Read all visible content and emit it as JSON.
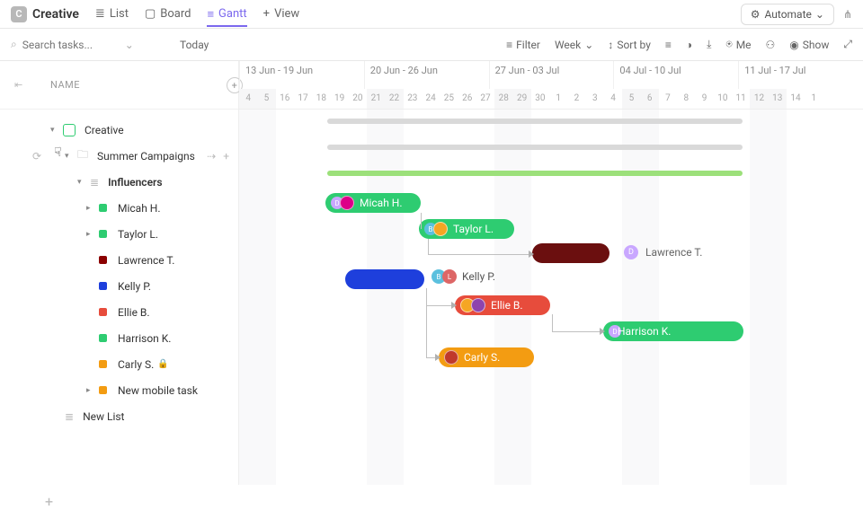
{
  "space": {
    "badge": "C",
    "name": "Creative"
  },
  "views": [
    {
      "id": "list",
      "label": "List",
      "glyph": "≣"
    },
    {
      "id": "board",
      "label": "Board",
      "glyph": "▢"
    },
    {
      "id": "gantt",
      "label": "Gantt",
      "glyph": "≡",
      "active": true
    },
    {
      "id": "add",
      "label": "View",
      "glyph": "+"
    }
  ],
  "automate": {
    "label": "Automate",
    "glyph": "✦"
  },
  "search": {
    "placeholder": "Search tasks...",
    "value": ""
  },
  "today": "Today",
  "toolbar": {
    "filter": "Filter",
    "group": "Week",
    "sort": "Sort by",
    "me": "Me",
    "show": "Show"
  },
  "sidebar": {
    "header": "NAME",
    "space": "Creative",
    "folder": "Summer Campaigns",
    "list": "Influencers",
    "tasks": [
      {
        "label": "Micah H.",
        "color": "#2ecc71",
        "caret": true
      },
      {
        "label": "Taylor L.",
        "color": "#2ecc71",
        "caret": true
      },
      {
        "label": "Lawrence T.",
        "color": "#8b0000"
      },
      {
        "label": "Kelly P.",
        "color": "#1e3fdc"
      },
      {
        "label": "Ellie B.",
        "color": "#e74c3c"
      },
      {
        "label": "Harrison K.",
        "color": "#2ecc71"
      },
      {
        "label": "Carly S.",
        "color": "#f39c12",
        "locked": true
      },
      {
        "label": "New mobile task",
        "color": "#f39c12",
        "caret": true
      }
    ],
    "newList": "New List"
  },
  "timeline": {
    "weeks": [
      {
        "label": "13 Jun - 19 Jun",
        "span": 7
      },
      {
        "label": "20 Jun - 26 Jun",
        "span": 7
      },
      {
        "label": "27 Jun - 03 Jul",
        "span": 7
      },
      {
        "label": "04 Jul - 10 Jul",
        "span": 7
      },
      {
        "label": "11 Jul - 17 Jul",
        "span": 7
      }
    ],
    "days": [
      "4",
      "5",
      "16",
      "17",
      "18",
      "19",
      "20",
      "21",
      "22",
      "23",
      "24",
      "25",
      "26",
      "27",
      "28",
      "29",
      "30",
      "1",
      "2",
      "3",
      "4",
      "5",
      "6",
      "7",
      "8",
      "9",
      "10",
      "11",
      "12",
      "13",
      "14",
      "1"
    ],
    "weekend_idx": [
      0,
      1,
      7,
      8,
      14,
      15,
      21,
      22,
      28,
      29
    ]
  },
  "bars": {
    "summary1": {
      "color": "#d9d9d9"
    },
    "summary2": {
      "color": "#d9d9d9"
    },
    "summary3": {
      "color": "#9ce07a"
    },
    "micah": {
      "label": "Micah H.",
      "color": "#2ecc71",
      "badge": "D",
      "badgeColor": "#c9a7ff"
    },
    "taylor": {
      "label": "Taylor L.",
      "color": "#2ecc71",
      "badge": "B",
      "badgeColor": "#5bc0de"
    },
    "lawrence": {
      "label": "Lawrence T.",
      "color": "#6b0f0f",
      "unscheduled": true,
      "badge": "D"
    },
    "kelly": {
      "label": "Kelly P.",
      "color": "#1e3fdc",
      "badge": "B",
      "badgeColor": "#5bc0de"
    },
    "ellie": {
      "label": "Ellie B.",
      "color": "#e74c3c"
    },
    "harrison": {
      "label": "Harrison K.",
      "color": "#2ecc71",
      "badge": "D",
      "badgeColor": "#c9a7ff"
    },
    "carly": {
      "label": "Carly S.",
      "color": "#f39c12"
    }
  },
  "chart_data": {
    "type": "gantt",
    "title": "Creative / Summer Campaigns / Influencers",
    "x_unit": "day",
    "x_range": [
      "2022-06-13",
      "2022-07-17"
    ],
    "tasks": [
      {
        "name": "Micah H.",
        "start": "2022-06-19",
        "end": "2022-06-23",
        "status": "green",
        "assignees": [
          "D"
        ]
      },
      {
        "name": "Taylor L.",
        "start": "2022-06-24",
        "end": "2022-06-28",
        "status": "green",
        "assignees": [
          "B",
          "A"
        ],
        "depends_on": [
          "Micah H."
        ]
      },
      {
        "name": "Lawrence T.",
        "start": "2022-06-30",
        "end": "2022-07-03",
        "status": "maroon",
        "unscheduled_label": true
      },
      {
        "name": "Kelly P.",
        "start": "2022-06-20",
        "end": "2022-06-24",
        "status": "blue",
        "assignees": [
          "B",
          "L"
        ]
      },
      {
        "name": "Ellie B.",
        "start": "2022-06-26",
        "end": "2022-06-30",
        "status": "red",
        "assignees": [
          "A"
        ],
        "depends_on": [
          "Kelly P."
        ]
      },
      {
        "name": "Harrison K.",
        "start": "2022-07-04",
        "end": "2022-07-11",
        "status": "green",
        "assignees": [
          "D"
        ],
        "depends_on": [
          "Ellie B."
        ]
      },
      {
        "name": "Carly S.",
        "start": "2022-06-25",
        "end": "2022-06-29",
        "status": "orange",
        "locked": true
      }
    ],
    "summary_bars": [
      {
        "level": "space",
        "start": "2022-06-19",
        "end": "2022-07-11"
      },
      {
        "level": "folder",
        "start": "2022-06-19",
        "end": "2022-07-11"
      },
      {
        "level": "list",
        "start": "2022-06-19",
        "end": "2022-07-11",
        "color": "#9ce07a"
      }
    ]
  }
}
